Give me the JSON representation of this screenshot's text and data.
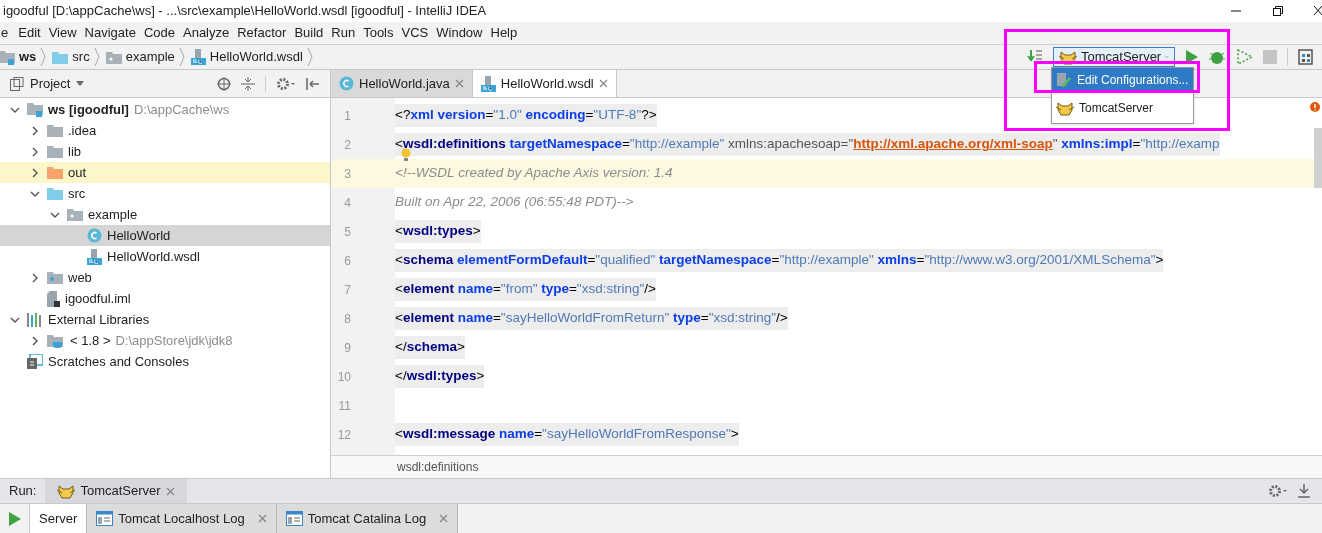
{
  "window": {
    "title": "igoodful [D:\\appCache\\ws] - ...\\src\\example\\HelloWorld.wsdl [igoodful] - IntelliJ IDEA"
  },
  "menu": [
    "e",
    "Edit",
    "View",
    "Navigate",
    "Code",
    "Analyze",
    "Refactor",
    "Build",
    "Run",
    "Tools",
    "VCS",
    "Window",
    "Help"
  ],
  "breadcrumbs": [
    {
      "label": "ws",
      "kind": "module"
    },
    {
      "label": "src",
      "kind": "source-folder"
    },
    {
      "label": "example",
      "kind": "package"
    },
    {
      "label": "HelloWorld.wsdl",
      "kind": "wsdl"
    }
  ],
  "run_config": {
    "label": "TomcatServer"
  },
  "run_menu": [
    {
      "label": "Edit Configurations...",
      "kind": "edit",
      "selected": true
    },
    {
      "label": "TomcatServer",
      "kind": "tomcat",
      "selected": false
    }
  ],
  "project_panel": {
    "title": "Project",
    "tree": [
      {
        "label": "ws [igoodful]",
        "detail": "D:\\appCache\\ws",
        "kind": "module",
        "expanded": true,
        "selected": false,
        "children": [
          {
            "label": ".idea",
            "kind": "folder",
            "expanded": false,
            "selected": false
          },
          {
            "label": "lib",
            "kind": "folder",
            "expanded": false,
            "selected": false
          },
          {
            "label": "out",
            "kind": "excluded-folder",
            "expanded": false,
            "selected": false,
            "highlighted": true
          },
          {
            "label": "src",
            "kind": "source-folder",
            "expanded": true,
            "selected": false,
            "children": [
              {
                "label": "example",
                "kind": "package",
                "expanded": true,
                "selected": false,
                "children": [
                  {
                    "label": "HelloWorld",
                    "kind": "class",
                    "selected": true
                  },
                  {
                    "label": "HelloWorld.wsdl",
                    "kind": "wsdl",
                    "selected": false
                  }
                ]
              }
            ]
          },
          {
            "label": "web",
            "kind": "web-folder",
            "expanded": false,
            "selected": false
          },
          {
            "label": "igoodful.iml",
            "kind": "iml",
            "selected": false
          }
        ]
      },
      {
        "label": "External Libraries",
        "kind": "libraries",
        "expanded": true,
        "selected": false,
        "children": [
          {
            "label": "< 1.8 >",
            "detail": "D:\\appStore\\jdk\\jdk8",
            "kind": "sdk",
            "expanded": false,
            "selected": false
          }
        ]
      },
      {
        "label": "Scratches and Consoles",
        "kind": "scratches",
        "selected": false
      }
    ]
  },
  "editor_tabs": [
    {
      "label": "HelloWorld.java",
      "kind": "class",
      "selected": false
    },
    {
      "label": "HelloWorld.wsdl",
      "kind": "wsdl",
      "selected": true
    }
  ],
  "code_lines": [
    {
      "number": "1",
      "current": false,
      "shaded": true,
      "tokens": [
        {
          "kind": "punct",
          "text": "<?"
        },
        {
          "kind": "attr",
          "text": "xml version"
        },
        {
          "kind": "punct",
          "text": "="
        },
        {
          "kind": "value",
          "text": "\"1.0\""
        },
        {
          "kind": "attr",
          "text": " encoding"
        },
        {
          "kind": "punct",
          "text": "="
        },
        {
          "kind": "value",
          "text": "\"UTF-8\""
        },
        {
          "kind": "punct",
          "text": "?>"
        }
      ]
    },
    {
      "number": "2",
      "current": false,
      "shaded": true,
      "tokens": [
        {
          "kind": "punct",
          "text": "<"
        },
        {
          "kind": "tag",
          "text": "wsdl:definitions"
        },
        {
          "kind": "attr",
          "text": " targetNamespace"
        },
        {
          "kind": "punct",
          "text": "="
        },
        {
          "kind": "value",
          "text": "\"http://example\""
        },
        {
          "kind": "ns",
          "text": " xmlns:apachesoap=\""
        },
        {
          "kind": "link",
          "text": "http://xml.apache.org/xml-soap"
        },
        {
          "kind": "ns",
          "text": "\""
        },
        {
          "kind": "attr",
          "text": " xmlns:impl"
        },
        {
          "kind": "punct",
          "text": "="
        },
        {
          "kind": "value",
          "text": "\"http://examp"
        }
      ]
    },
    {
      "number": "3",
      "current": true,
      "shaded": false,
      "tokens": [
        {
          "kind": "comment",
          "text": "<!--WSDL created by Apache Axis version: 1.4"
        }
      ]
    },
    {
      "number": "4",
      "current": false,
      "shaded": false,
      "tokens": [
        {
          "kind": "comment",
          "text": "Built on Apr 22, 2006 (06:55:48 PDT)-->"
        }
      ]
    },
    {
      "number": "5",
      "current": false,
      "shaded": true,
      "tokens": [
        {
          "kind": "punct",
          "text": "<"
        },
        {
          "kind": "tag",
          "text": "wsdl:types"
        },
        {
          "kind": "punct",
          "text": ">"
        }
      ]
    },
    {
      "number": "6",
      "current": false,
      "shaded": true,
      "tokens": [
        {
          "kind": "punct",
          "text": "<"
        },
        {
          "kind": "tag",
          "text": "schema"
        },
        {
          "kind": "attr",
          "text": " elementFormDefault"
        },
        {
          "kind": "punct",
          "text": "="
        },
        {
          "kind": "value",
          "text": "\"qualified\""
        },
        {
          "kind": "attr",
          "text": " targetNamespace"
        },
        {
          "kind": "punct",
          "text": "="
        },
        {
          "kind": "value",
          "text": "\"http://example\""
        },
        {
          "kind": "attr",
          "text": " xmlns"
        },
        {
          "kind": "punct",
          "text": "="
        },
        {
          "kind": "value",
          "text": "\"http://www.w3.org/2001/XMLSchema\""
        },
        {
          "kind": "punct",
          "text": ">"
        }
      ]
    },
    {
      "number": "7",
      "current": false,
      "shaded": true,
      "tokens": [
        {
          "kind": "punct",
          "text": "<"
        },
        {
          "kind": "tag",
          "text": "element"
        },
        {
          "kind": "attr",
          "text": " name"
        },
        {
          "kind": "punct",
          "text": "="
        },
        {
          "kind": "value",
          "text": "\"from\""
        },
        {
          "kind": "attr",
          "text": " type"
        },
        {
          "kind": "punct",
          "text": "="
        },
        {
          "kind": "value",
          "text": "\"xsd:string\""
        },
        {
          "kind": "punct",
          "text": "/>"
        }
      ]
    },
    {
      "number": "8",
      "current": false,
      "shaded": true,
      "tokens": [
        {
          "kind": "punct",
          "text": "<"
        },
        {
          "kind": "tag",
          "text": "element"
        },
        {
          "kind": "attr",
          "text": " name"
        },
        {
          "kind": "punct",
          "text": "="
        },
        {
          "kind": "value",
          "text": "\"sayHelloWorldFromReturn\""
        },
        {
          "kind": "attr",
          "text": " type"
        },
        {
          "kind": "punct",
          "text": "="
        },
        {
          "kind": "value",
          "text": "\"xsd:string\""
        },
        {
          "kind": "punct",
          "text": "/>"
        }
      ]
    },
    {
      "number": "9",
      "current": false,
      "shaded": true,
      "tokens": [
        {
          "kind": "punct",
          "text": "</"
        },
        {
          "kind": "tag",
          "text": "schema"
        },
        {
          "kind": "punct",
          "text": ">"
        }
      ]
    },
    {
      "number": "10",
      "current": false,
      "shaded": true,
      "tokens": [
        {
          "kind": "punct",
          "text": "</"
        },
        {
          "kind": "tag",
          "text": "wsdl:types"
        },
        {
          "kind": "punct",
          "text": ">"
        }
      ]
    },
    {
      "number": "11",
      "current": false
    },
    {
      "number": "12",
      "current": false,
      "shaded": true,
      "tokens": [
        {
          "kind": "punct",
          "text": "<"
        },
        {
          "kind": "tag",
          "text": "wsdl:message"
        },
        {
          "kind": "attr",
          "text": " name"
        },
        {
          "kind": "punct",
          "text": "="
        },
        {
          "kind": "value",
          "text": "\"sayHelloWorldFromResponse\""
        },
        {
          "kind": "punct",
          "text": ">"
        }
      ]
    }
  ],
  "editor_breadcrumb": "wsdl:definitions",
  "run_panel": {
    "label": "Run:",
    "config_tab": "TomcatServer",
    "tabs": [
      {
        "label": "Server",
        "kind": "plain",
        "closable": false,
        "selected": true
      },
      {
        "label": "Tomcat Localhost Log",
        "kind": "log",
        "closable": true,
        "selected": false
      },
      {
        "label": "Tomcat Catalina Log",
        "kind": "log",
        "closable": true,
        "selected": false
      }
    ]
  }
}
